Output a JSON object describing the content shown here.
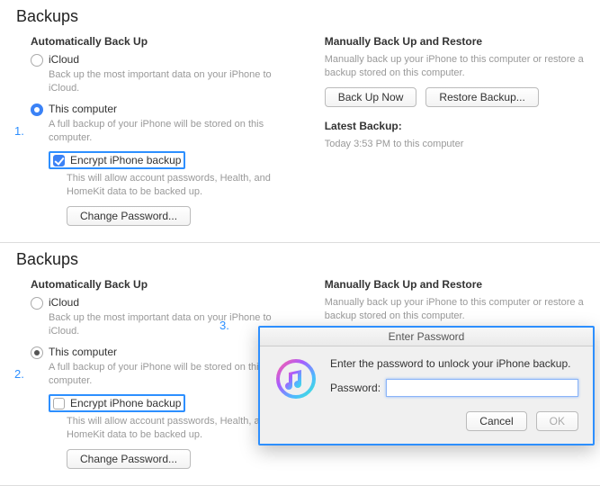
{
  "section_title": "Backups",
  "left": {
    "auto_heading": "Automatically Back Up",
    "icloud_label": "iCloud",
    "icloud_sub": "Back up the most important data on your iPhone to iCloud.",
    "thispc_label": "This computer",
    "thispc_sub": "A full backup of your iPhone will be stored on this computer.",
    "encrypt_label": "Encrypt iPhone backup",
    "encrypt_sub": "This will allow account passwords, Health, and HomeKit data to be backed up.",
    "change_pw": "Change Password..."
  },
  "right": {
    "manual_heading": "Manually Back Up and Restore",
    "manual_sub": "Manually back up your iPhone to this computer or restore a backup stored on this computer.",
    "backup_now": "Back Up Now",
    "restore": "Restore Backup...",
    "latest_heading": "Latest Backup:",
    "latest_value": "Today 3:53 PM to this computer"
  },
  "steps": {
    "one": "1.",
    "two": "2.",
    "three": "3."
  },
  "dialog": {
    "title": "Enter Password",
    "message": "Enter the password to unlock your iPhone backup.",
    "pw_label": "Password:",
    "cancel": "Cancel",
    "ok": "OK"
  }
}
